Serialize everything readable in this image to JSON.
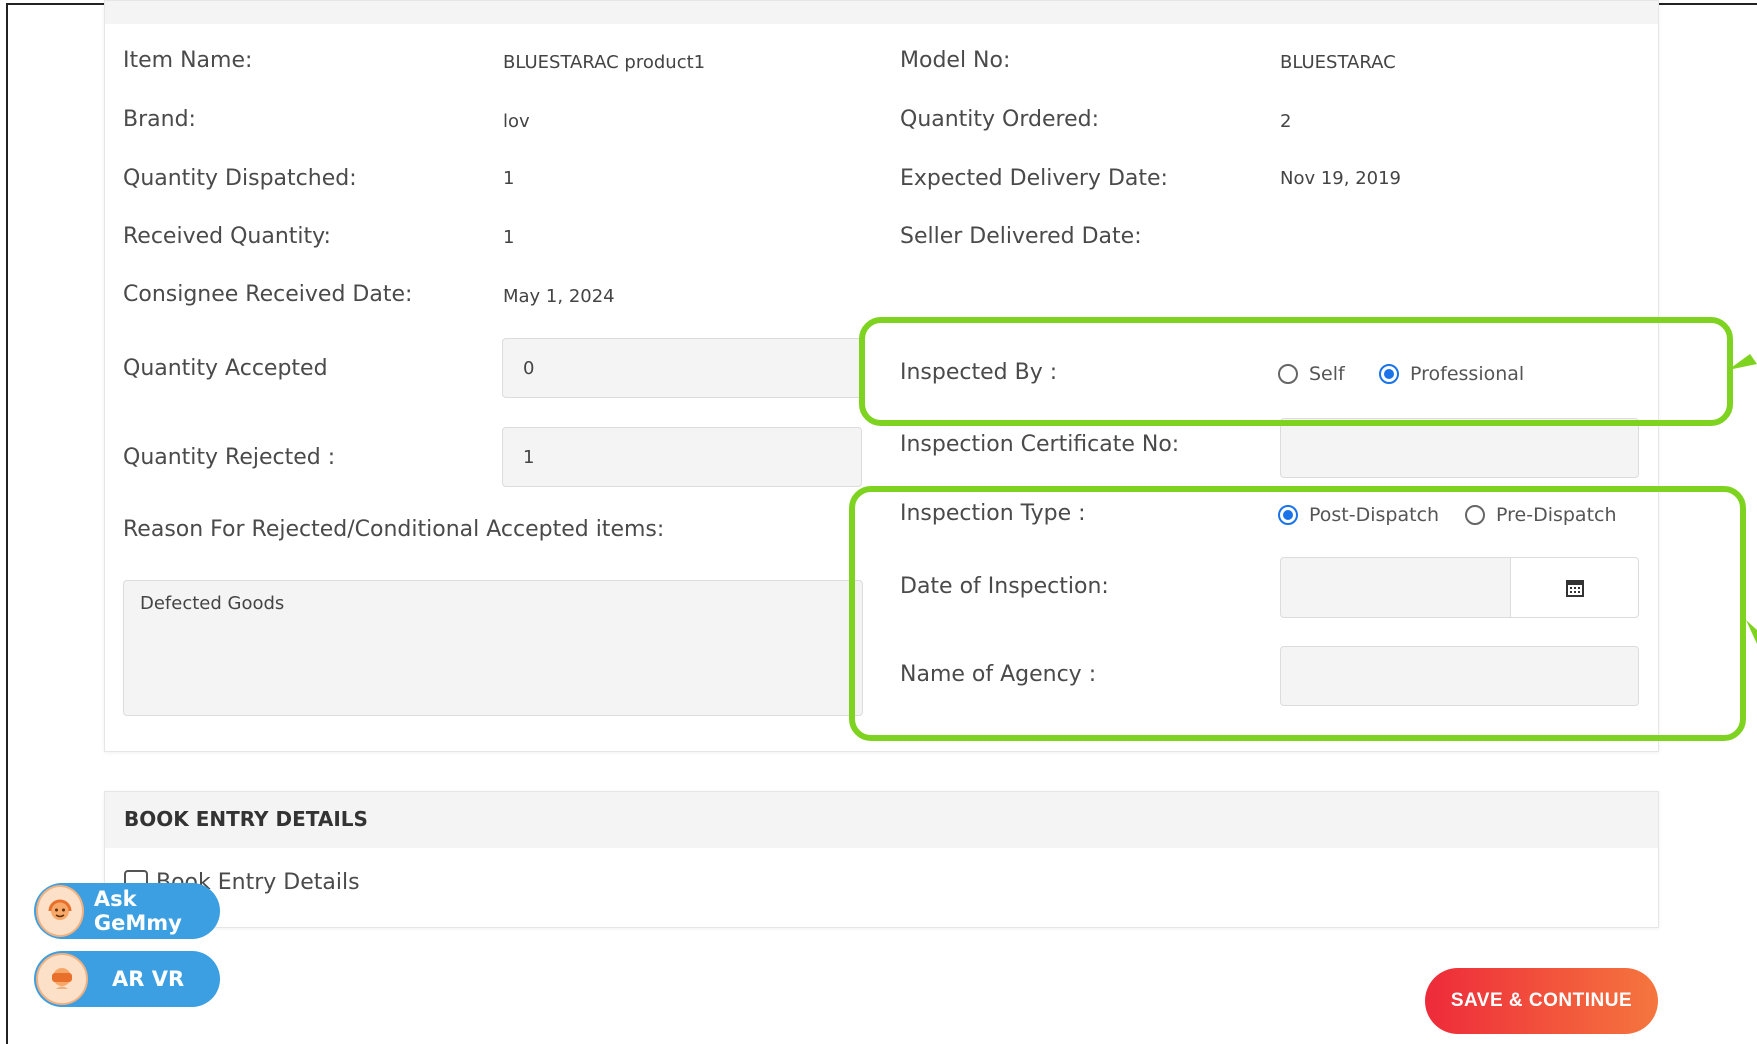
{
  "product": {
    "item_name_label": "Item Name:",
    "item_name_value": "BLUESTARAC product1",
    "model_no_label": "Model No:",
    "model_no_value": "BLUESTARAC",
    "brand_label": "Brand:",
    "brand_value": "lov",
    "qty_ordered_label": "Quantity Ordered:",
    "qty_ordered_value": "2",
    "qty_dispatched_label": "Quantity Dispatched:",
    "qty_dispatched_value": "1",
    "expected_delivery_label": "Expected Delivery Date:",
    "expected_delivery_value": "Nov 19, 2019",
    "received_qty_label": "Received Quantity:",
    "received_qty_value": "1",
    "seller_delivered_label": "Seller Delivered Date:",
    "consignee_received_label": "Consignee Received Date:",
    "consignee_received_value": "May 1, 2024",
    "qty_accepted_label": "Quantity Accepted",
    "qty_accepted_value": "0",
    "qty_rejected_label": "Quantity Rejected :",
    "qty_rejected_value": "1",
    "reason_label": "Reason For Rejected/Conditional Accepted items:",
    "reason_value": "Defected Goods"
  },
  "inspection": {
    "inspected_by_label": "Inspected By :",
    "inspected_by_options": [
      "Self",
      "Professional"
    ],
    "inspected_by_selected": "Professional",
    "certificate_label": "Inspection Certificate No:",
    "type_label": "Inspection Type :",
    "type_options": [
      "Post-Dispatch",
      "Pre-Dispatch"
    ],
    "type_selected": "Post-Dispatch",
    "date_label": "Date of Inspection:",
    "agency_label": "Name of Agency :"
  },
  "book_entry": {
    "section_title": "BOOK ENTRY DETAILS",
    "checkbox_label": "Book Entry Details"
  },
  "floating": {
    "ask_label": "Ask GeMmy",
    "arvr_label": "AR VR"
  },
  "actions": {
    "save_label": "SAVE & CONTINUE"
  },
  "colors": {
    "highlight": "#7ed321",
    "radio_selected": "#1a73e8",
    "pill": "#3b9fe2",
    "save_gradient_start": "#ee2a3a",
    "save_gradient_end": "#f5763e"
  }
}
